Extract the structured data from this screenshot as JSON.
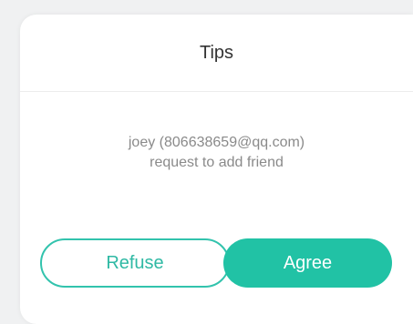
{
  "dialog": {
    "title": "Tips",
    "message_line1": "joey (806638659@qq.com)",
    "message_line2": "request to add friend",
    "refuse_label": "Refuse",
    "agree_label": "Agree"
  },
  "colors": {
    "accent": "#21c2a5",
    "text_muted": "#8a8a8a",
    "title_text": "#333333"
  }
}
